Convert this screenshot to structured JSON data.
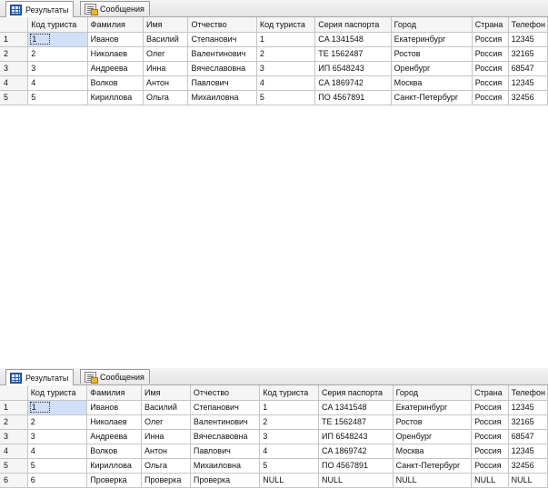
{
  "tabs": {
    "results": "Результаты",
    "messages": "Сообщения"
  },
  "columns": [
    "Код туриста",
    "Фамилия",
    "Имя",
    "Отчество",
    "Код туриста",
    "Серия паспорта",
    "Город",
    "Страна",
    "Телефон"
  ],
  "query1": {
    "rows": [
      {
        "n": "1",
        "cells": [
          "1",
          "Иванов",
          "Василий",
          "Степанович",
          "1",
          "CA 1341548",
          "Екатеринбург",
          "Россия",
          "12345"
        ]
      },
      {
        "n": "2",
        "cells": [
          "2",
          "Николаев",
          "Олег",
          "Валентинович",
          "2",
          "TE 1562487",
          "Ростов",
          "Россия",
          "32165"
        ]
      },
      {
        "n": "3",
        "cells": [
          "3",
          "Андреева",
          "Инна",
          "Вячеславовна",
          "3",
          "ИП 6548243",
          "Оренбург",
          "Россия",
          "68547"
        ]
      },
      {
        "n": "4",
        "cells": [
          "4",
          "Волков",
          "Антон",
          "Павлович",
          "4",
          "CA 1869742",
          "Москва",
          "Россия",
          "12345"
        ]
      },
      {
        "n": "5",
        "cells": [
          "5",
          "Кириллова",
          "Ольга",
          "Михаиловна",
          "5",
          "ПО 4567891",
          "Санкт-Петербург",
          "Россия",
          "32456"
        ]
      }
    ]
  },
  "query2": {
    "rows": [
      {
        "n": "1",
        "cells": [
          "1",
          "Иванов",
          "Василий",
          "Степанович",
          "1",
          "CA 1341548",
          "Екатеринбург",
          "Россия",
          "12345"
        ]
      },
      {
        "n": "2",
        "cells": [
          "2",
          "Николаев",
          "Олег",
          "Валентинович",
          "2",
          "TE 1562487",
          "Ростов",
          "Россия",
          "32165"
        ]
      },
      {
        "n": "3",
        "cells": [
          "3",
          "Андреева",
          "Инна",
          "Вячеславовна",
          "3",
          "ИП 6548243",
          "Оренбург",
          "Россия",
          "68547"
        ]
      },
      {
        "n": "4",
        "cells": [
          "4",
          "Волков",
          "Антон",
          "Павлович",
          "4",
          "CA 1869742",
          "Москва",
          "Россия",
          "12345"
        ]
      },
      {
        "n": "5",
        "cells": [
          "5",
          "Кириллова",
          "Ольга",
          "Михаиловна",
          "5",
          "ПО 4567891",
          "Санкт-Петербург",
          "Россия",
          "32456"
        ]
      },
      {
        "n": "6",
        "cells": [
          "6",
          "Проверка",
          "Проверка",
          "Проверка",
          "NULL",
          "NULL",
          "NULL",
          "NULL",
          "NULL"
        ]
      }
    ]
  }
}
